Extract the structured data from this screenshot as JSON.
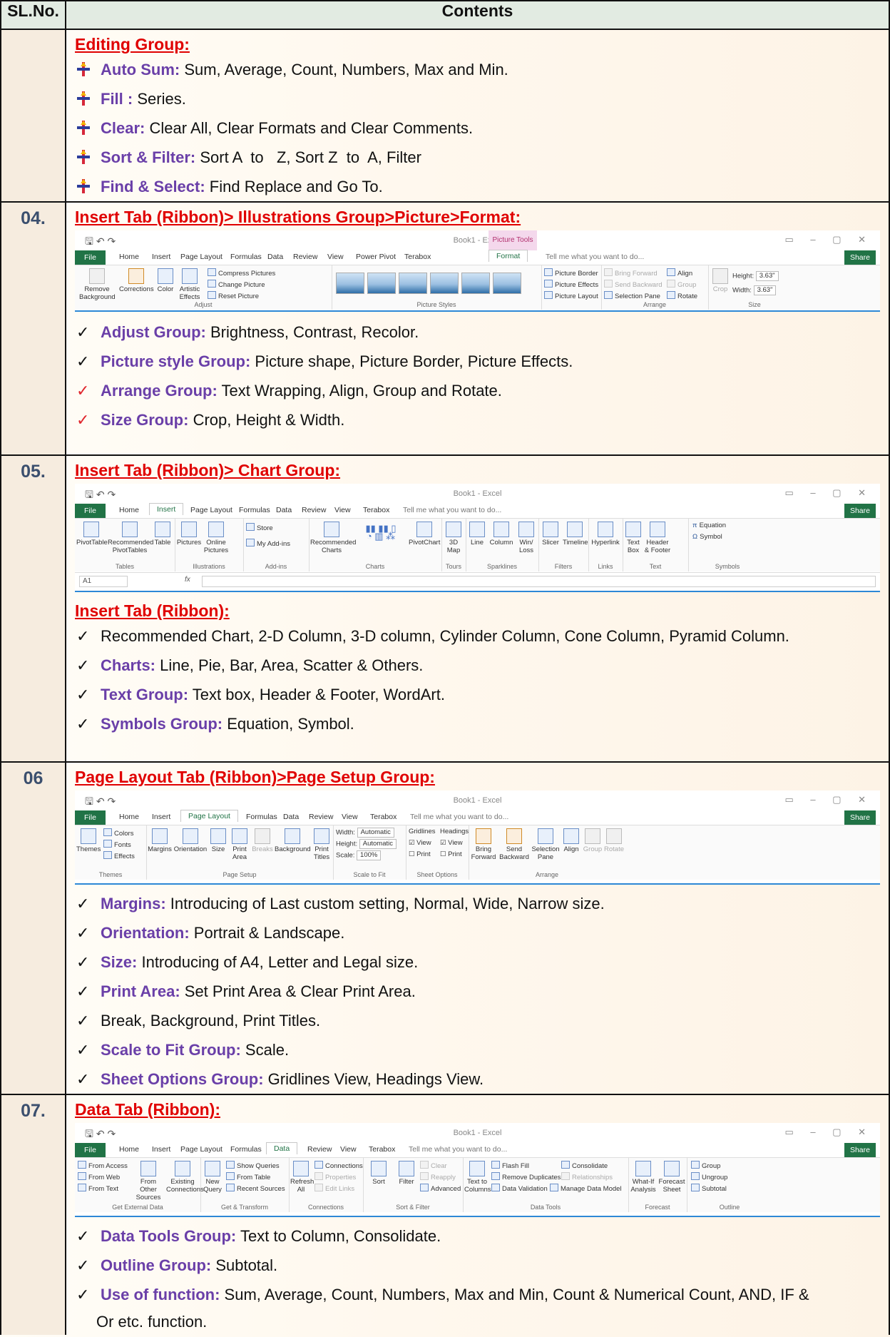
{
  "header": {
    "col1": "SL.No.",
    "col2": "Contents"
  },
  "editing": {
    "title": "Editing Group:",
    "items": [
      {
        "k": "Auto Sum:",
        "v": " Sum, Average, Count, Numbers, Max and Min."
      },
      {
        "k": "Fill :",
        "v": " Series."
      },
      {
        "k": "Clear:",
        "v": " Clear All, Clear Formats and Clear Comments."
      },
      {
        "k": "Sort & Filter:",
        "v": " Sort A  to   Z, Sort Z  to  A, Filter"
      },
      {
        "k": "Find & Select:",
        "v": " Find Replace and Go To."
      }
    ]
  },
  "s04": {
    "num": "04.",
    "title": "Insert Tab (Ribbon)> Illustrations Group>Picture>Format:",
    "ribbon": {
      "book_title": "Book1 - Excel",
      "picture_tools": "Picture Tools",
      "tabs": [
        "File",
        "Home",
        "Insert",
        "Page Layout",
        "Formulas",
        "Data",
        "Review",
        "View",
        "Power Pivot",
        "Terabox",
        "Format"
      ],
      "tell": "Tell me what you want to do...",
      "share": "Share",
      "adjust": {
        "remove_bg": "Remove Background",
        "corrections": "Corrections",
        "color": "Color",
        "artistic": "Artistic Effects",
        "compress": "Compress Pictures",
        "change": "Change Picture",
        "reset": "Reset Picture",
        "label": "Adjust"
      },
      "styles_label": "Picture Styles",
      "border": "Picture Border",
      "effects": "Picture Effects",
      "layout": "Picture Layout",
      "arrange": {
        "bring": "Bring Forward",
        "send": "Send Backward",
        "pane": "Selection Pane",
        "align": "Align",
        "group": "Group",
        "rotate": "Rotate",
        "label": "Arrange"
      },
      "size": {
        "crop": "Crop",
        "height_lbl": "Height:",
        "height": "3.63\"",
        "width_lbl": "Width:",
        "width": "3.63\"",
        "label": "Size"
      }
    },
    "items": [
      {
        "k": "Adjust Group:",
        "v": " Brightness, Contrast, Recolor.",
        "red": false
      },
      {
        "k": "Picture style Group:",
        "v": " Picture shape, Picture Border, Picture Effects.",
        "red": false
      },
      {
        "k": "Arrange Group:",
        "v": " Text Wrapping, Align, Group and Rotate.",
        "red": true
      },
      {
        "k": "Size Group:",
        "v": " Crop, Height & Width.",
        "red": true
      }
    ]
  },
  "s05": {
    "num": "05.",
    "title": "Insert Tab (Ribbon)> Chart Group:",
    "ribbon": {
      "book_title": "Book1 - Excel",
      "tabs": [
        "File",
        "Home",
        "Insert",
        "Page Layout",
        "Formulas",
        "Data",
        "Review",
        "View",
        "Terabox"
      ],
      "tell": "Tell me what you want to do...",
      "share": "Share",
      "pivot": "PivotTable",
      "rec_pivot": "Recommended PivotTables",
      "table": "Table",
      "tables_label": "Tables",
      "pictures": "Pictures",
      "online": "Online Pictures",
      "ill_label": "Illustrations",
      "store": "Store",
      "addins": "My Add-ins",
      "addins_label": "Add-ins",
      "rec_charts": "Recommended Charts",
      "charts_label": "Charts",
      "pivotchart": "PivotChart",
      "map3d": "3D Map",
      "tours_label": "Tours",
      "line": "Line",
      "column": "Column",
      "winloss": "Win/ Loss",
      "spark_label": "Sparklines",
      "slicer": "Slicer",
      "timeline": "Timeline",
      "filters_label": "Filters",
      "hyperlink": "Hyperlink",
      "links_label": "Links",
      "textbox": "Text Box",
      "header": "Header & Footer",
      "text_label": "Text",
      "equation": "Equation",
      "symbol": "Symbol",
      "symbols_label": "Symbols",
      "namebox": "A1",
      "fx": "fx"
    },
    "sub_title": "Insert Tab (Ribbon):",
    "items": [
      {
        "k": "",
        "v": "Recommended Chart, 2-D Column, 3-D column, Cylinder Column, Cone Column, Pyramid Column."
      },
      {
        "k": "Charts:",
        "v": " Line, Pie, Bar, Area, Scatter & Others."
      },
      {
        "k": "Text Group:",
        "v": " Text box, Header & Footer, WordArt."
      },
      {
        "k": "Symbols Group:",
        "v": " Equation, Symbol."
      }
    ]
  },
  "s06": {
    "num": "06",
    "title": "Page Layout Tab (Ribbon)>Page Setup Group:",
    "ribbon": {
      "book_title": "Book1 - Excel",
      "tabs": [
        "File",
        "Home",
        "Insert",
        "Page Layout",
        "Formulas",
        "Data",
        "Review",
        "View",
        "Terabox"
      ],
      "tell": "Tell me what you want to do...",
      "share": "Share",
      "themes": "Themes",
      "colors": "Colors",
      "fonts": "Fonts",
      "effects": "Effects",
      "themes_label": "Themes",
      "margins": "Margins",
      "orientation": "Orientation",
      "size": "Size",
      "print_area": "Print Area",
      "breaks": "Breaks",
      "background": "Background",
      "print_titles": "Print Titles",
      "setup_label": "Page Setup",
      "width_lbl": "Width:",
      "height_lbl": "Height:",
      "scale_lbl": "Scale:",
      "auto": "Automatic",
      "scale": "100%",
      "fit_label": "Scale to Fit",
      "gridlines": "Gridlines",
      "headings": "Headings",
      "view": "View",
      "print": "Print",
      "sheet_label": "Sheet Options",
      "bring": "Bring Forward",
      "send": "Send Backward",
      "pane": "Selection Pane",
      "align": "Align",
      "group": "Group",
      "rotate": "Rotate",
      "arrange_label": "Arrange"
    },
    "items": [
      {
        "k": "Margins:",
        "v": " Introducing of Last custom setting, Normal, Wide, Narrow size."
      },
      {
        "k": "Orientation:",
        "v": " Portrait & Landscape."
      },
      {
        "k": "Size:",
        "v": " Introducing of A4, Letter and Legal size."
      },
      {
        "k": "Print Area:",
        "v": " Set Print Area & Clear Print Area."
      },
      {
        "k": "",
        "v": "Break, Background, Print Titles."
      },
      {
        "k": "Scale to Fit Group:",
        "v": " Scale."
      },
      {
        "k": "Sheet Options Group:",
        "v": " Gridlines View, Headings View."
      }
    ]
  },
  "s07": {
    "num": "07.",
    "title": "Data Tab (Ribbon):",
    "ribbon": {
      "book_title": "Book1 - Excel",
      "tabs": [
        "File",
        "Home",
        "Insert",
        "Page Layout",
        "Formulas",
        "Data",
        "Review",
        "View",
        "Terabox"
      ],
      "tell": "Tell me what you want to do...",
      "share": "Share",
      "access": "From Access",
      "web": "From Web",
      "text": "From Text",
      "other": "From Other Sources",
      "existing": "Existing Connections",
      "ext_label": "Get External Data",
      "newq": "New Query",
      "showq": "Show Queries",
      "fromtable": "From Table",
      "recent": "Recent Sources",
      "gt_label": "Get & Transform",
      "refresh": "Refresh All",
      "connections": "Connections",
      "properties": "Properties",
      "editlinks": "Edit Links",
      "conn_label": "Connections",
      "sort": "Sort",
      "filter": "Filter",
      "clear": "Clear",
      "reapply": "Reapply",
      "advanced": "Advanced",
      "sf_label": "Sort & Filter",
      "t2c": "Text to Columns",
      "flash": "Flash Fill",
      "remdup": "Remove Duplicates",
      "validation": "Data Validation",
      "consolidate": "Consolidate",
      "relationships": "Relationships",
      "model": "Manage Data Model",
      "dt_label": "Data Tools",
      "whatif": "What-If Analysis",
      "forecast": "Forecast Sheet",
      "fc_label": "Forecast",
      "group": "Group",
      "ungroup": "Ungroup",
      "subtotal": "Subtotal",
      "ol_label": "Outline"
    },
    "items": [
      {
        "k": "Data Tools Group:",
        "v": " Text to Column, Consolidate."
      },
      {
        "k": "Outline Group:",
        "v": " Subtotal."
      },
      {
        "k": "Use of function:",
        "v": " Sum, Average, Count, Numbers, Max and Min, Count & Numerical Count, AND, IF &"
      }
    ],
    "cont": "Or etc. function."
  },
  "colors": {
    "title_red": "#e00000",
    "key_purple": "#6a3fa8",
    "excel_green": "#217346",
    "check_red": "#e0252c"
  }
}
